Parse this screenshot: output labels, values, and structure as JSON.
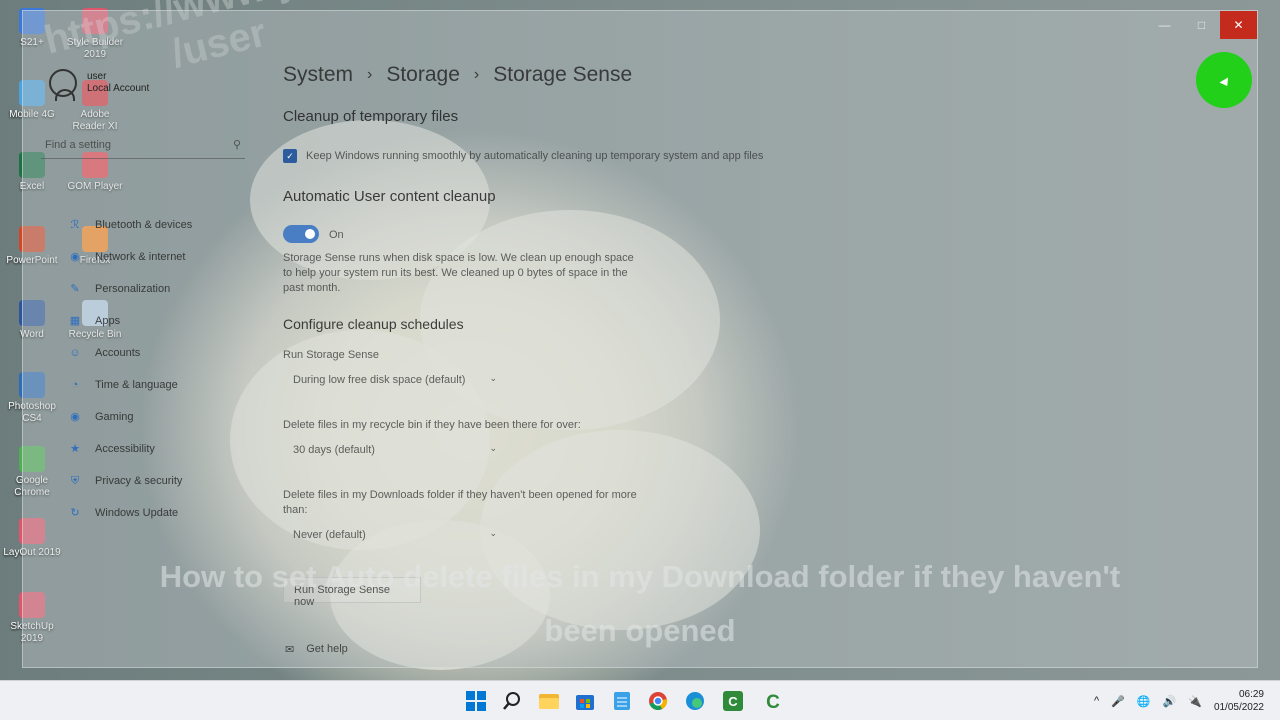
{
  "window": {
    "breadcrumb": [
      "System",
      "Storage",
      "Storage Sense"
    ],
    "controls": {
      "minimize": "—",
      "maximize": "□",
      "close": "✕"
    }
  },
  "account": {
    "name": "user",
    "type": "Local Account"
  },
  "search": {
    "placeholder": "Find a setting"
  },
  "nav": [
    {
      "label": "Bluetooth & devices",
      "icon": "bluetooth-icon"
    },
    {
      "label": "Network & internet",
      "icon": "network-icon"
    },
    {
      "label": "Personalization",
      "icon": "brush-icon"
    },
    {
      "label": "Apps",
      "icon": "apps-icon"
    },
    {
      "label": "Accounts",
      "icon": "person-icon"
    },
    {
      "label": "Time & language",
      "icon": "globe-icon"
    },
    {
      "label": "Gaming",
      "icon": "gamepad-icon"
    },
    {
      "label": "Accessibility",
      "icon": "accessibility-icon"
    },
    {
      "label": "Privacy & security",
      "icon": "shield-icon"
    },
    {
      "label": "Windows Update",
      "icon": "update-icon"
    }
  ],
  "content": {
    "temp_title": "Cleanup of temporary files",
    "temp_checkbox": "Keep Windows running smoothly by automatically cleaning up temporary system and app files",
    "auto_title": "Automatic User content cleanup",
    "toggle_state": "On",
    "auto_desc": "Storage Sense runs when disk space is low. We clean up enough space to help your system run its best. We cleaned up 0 bytes of space in the past month.",
    "schedule_title": "Configure cleanup schedules",
    "run_label": "Run Storage Sense",
    "run_value": "During low free disk space (default)",
    "recycle_label": "Delete files in my recycle bin if they have been there for over:",
    "recycle_value": "30 days (default)",
    "downloads_label": "Delete files in my Downloads folder if they haven't been opened for more than:",
    "downloads_value": "Never (default)",
    "run_now": "Run Storage Sense now",
    "get_help": "Get help"
  },
  "desktop_icons": [
    {
      "label": "S21+",
      "color": "#3b78d8"
    },
    {
      "label": "Style Builder 2019",
      "color": "#e0556a"
    },
    {
      "label": "Mobile 4G",
      "color": "#4aa3df"
    },
    {
      "label": "Adobe Reader XI",
      "color": "#d9363e"
    },
    {
      "label": "Excel",
      "color": "#1e7145"
    },
    {
      "label": "GOM Player",
      "color": "#e8434a"
    },
    {
      "label": "PowerPoint",
      "color": "#d24726"
    },
    {
      "label": "Firefox",
      "color": "#ff8a1c"
    },
    {
      "label": "Word",
      "color": "#2b579a"
    },
    {
      "label": "Recycle Bin",
      "color": "#b9d3e8"
    },
    {
      "label": "Photoshop CS4",
      "color": "#2d6db5"
    },
    {
      "label": "Google Chrome",
      "color": "#4caf50"
    },
    {
      "label": "LayOut 2019",
      "color": "#e0556a"
    },
    {
      "label": "SketchUp 2019",
      "color": "#e0556a"
    }
  ],
  "watermark": {
    "line1": "https://www.youtube.com",
    "line2": "/user"
  },
  "caption": {
    "line1": "How to set Auto delete files in my Download folder if they haven't",
    "line2": "been opened"
  },
  "taskbar": {
    "apps": [
      "windows-start-icon",
      "search-icon",
      "file-explorer-icon",
      "store-icon",
      "notepad-icon",
      "chrome-icon",
      "edge-icon",
      "camtasia-icon",
      "camtasia-recorder-icon"
    ],
    "time": "06:29",
    "date": "01/05/2022",
    "tray_chevron": "^"
  }
}
